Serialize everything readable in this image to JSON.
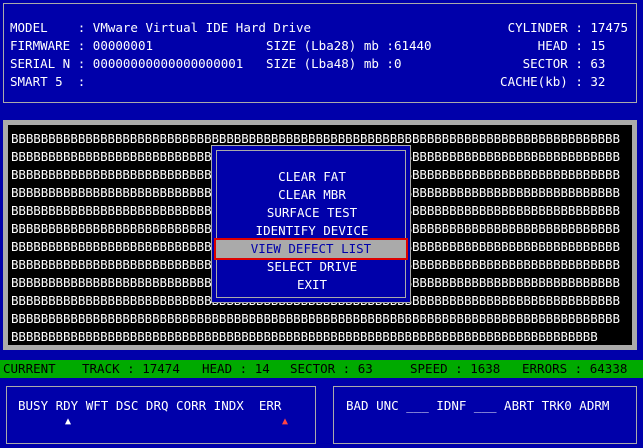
{
  "header": {
    "model_label": "MODEL",
    "model_value": ": VMware Virtual IDE Hard Drive",
    "firmware_label": "FIRMWARE",
    "firmware_value": ": 00000001",
    "serial_label": "SERIAL N",
    "serial_value": ": 00000000000000000001",
    "smart_label": "SMART 5",
    "smart_value": ":",
    "size28_label": "SIZE (Lba28) mb",
    "size28_value": ":61440",
    "size48_label": "SIZE (Lba48) mb",
    "size48_value": ":0",
    "cylinder_label": "CYLINDER",
    "cylinder_value": ": 17475",
    "head_label": "HEAD",
    "head_value": ": 15",
    "sector_label": "SECTOR",
    "sector_value": ": 63",
    "cache_label": "CACHE(kb)",
    "cache_value": ": 32"
  },
  "surface": {
    "grid_text": "BBBBBBBBBBBBBBBBBBBBBBBBBBBBBBBBBBBBBBBBBBBBBBBBBBBBBBBBBBBBBBBBBBBBBBBBBBBBBBBBBB\nBBBBBBBBBBBBBBBBBBBBBBBBBBBBBBBBBBBBBBBBBBBBBBBBBBBBBBBBBBBBBBBBBBBBBBBBBBBBBBBBBB\nBBBBBBBBBBBBBBBBBBBBBBBBBBBBBBBBBBBBBBBBBBBBBBBBBBBBBBBBBBBBBBBBBBBBBBBBBBBBBBBBBB\nBBBBBBBBBBBBBBBBBBBBBBBBBBBBBBBBBBBBBBBBBBBBBBBBBBBBBBBBBBBBBBBBBBBBBBBBBBBBBBBBBB\nBBBBBBBBBBBBBBBBBBBBBBBBBBBBBBBBBBBBBBBBBBBBBBBBBBBBBBBBBBBBBBBBBBBBBBBBBBBBBBBBBB\nBBBBBBBBBBBBBBBBBBBBBBBBBBBBBBBBBBBBBBBBBBBBBBBBBBBBBBBBBBBBBBBBBBBBBBBBBBBBBBBBBB\nBBBBBBBBBBBBBBBBBBBBBBBBBBBBBBBBBBBBBBBBBBBBBBBBBBBBBBBBBBBBBBBBBBBBBBBBBBBBBBBBBB\nBBBBBBBBBBBBBBBBBBBBBBBBBBBBBBBBBBBBBBBBBBBBBBBBBBBBBBBBBBBBBBBBBBBBBBBBBBBBBBBBBB\nBBBBBBBBBBBBBBBBBBBBBBBBBBBBBBBBBBBBBBBBBBBBBBBBBBBBBBBBBBBBBBBBBBBBBBBBBBBBBBBBBB\nBBBBBBBBBBBBBBBBBBBBBBBBBBBBBBBBBBBBBBBBBBBBBBBBBBBBBBBBBBBBBBBBBBBBBBBBBBBBBBBBBB\nBBBBBBBBBBBBBBBBBBBBBBBBBBBBBBBBBBBBBBBBBBBBBBBBBBBBBBBBBBBBBBBBBBBBBBBBBBBBBBBBBB\nBBBBBBBBBBBBBBBBBBBBBBBBBBBBBBBBBBBBBBBBBBBBBBBBBBBBBBBBBBBBBBBBBBBBBBBBBBBBBBB"
  },
  "menu": {
    "items": [
      "CLEAR FAT",
      "CLEAR MBR",
      "SURFACE TEST",
      "IDENTIFY  DEVICE",
      "VIEW DEFECT LIST",
      "SELECT DRIVE",
      "EXIT"
    ],
    "selected": "VIEW DEFECT LIST"
  },
  "status": {
    "current_label": "CURRENT",
    "track_label": "TRACK :",
    "track_value": "17474",
    "head_label": "HEAD :",
    "head_value": "14",
    "sector_label": "SECTOR :",
    "sector_value": "63",
    "speed_label": "SPEED :",
    "speed_value": "1638",
    "errors_label": "ERRORS :",
    "errors_value": "64338"
  },
  "flags_left": {
    "text": "BUSY RDY WFT DSC DRQ CORR INDX  ERR",
    "rdy_marker": "▲",
    "err_marker": "▲"
  },
  "flags_right": {
    "text": "BAD UNC ___ IDNF ___ ABRT TRK0 ADRM"
  },
  "colors": {
    "background": "#0000aa",
    "status_bar": "#00aa00",
    "surface": "#aaaaaa",
    "selection_outline": "#dd0000",
    "err_marker": "#ff4444"
  }
}
